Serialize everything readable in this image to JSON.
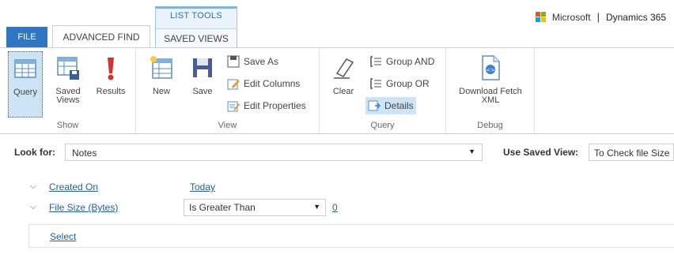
{
  "tabs": {
    "file": "FILE",
    "advanced_find": "ADVANCED FIND",
    "list_tools": "LIST TOOLS",
    "saved_views": "SAVED VIEWS"
  },
  "brand": {
    "microsoft": "Microsoft",
    "separator": "|",
    "product": "Dynamics 365"
  },
  "ribbon": {
    "show": {
      "label": "Show",
      "query": "Query",
      "saved_views_line1": "Saved",
      "saved_views_line2": "Views",
      "results": "Results"
    },
    "view": {
      "label": "View",
      "new": "New",
      "save": "Save",
      "save_as": "Save As",
      "edit_columns": "Edit Columns",
      "edit_properties": "Edit Properties"
    },
    "query": {
      "label": "Query",
      "clear": "Clear",
      "group_and": "Group AND",
      "group_or": "Group OR",
      "details": "Details"
    },
    "debug": {
      "label": "Debug",
      "download_line1": "Download Fetch",
      "download_line2": "XML"
    }
  },
  "lookfor": {
    "label": "Look for:",
    "value": "Notes",
    "use_saved_view_label": "Use Saved View:",
    "saved_view_value": "To Check file Size"
  },
  "criteria": [
    {
      "field": "Created On",
      "operator": "Today",
      "value": ""
    },
    {
      "field": "File Size (Bytes)",
      "operator": "Is Greater Than",
      "value": "0"
    }
  ],
  "select_link": "Select",
  "colors": {
    "file_tab": "#2f77c3",
    "link": "#1f5fa8",
    "selected": "#cde3f6",
    "ms_red": "#f25022",
    "ms_green": "#7fba00",
    "ms_blue": "#00a4ef",
    "ms_yellow": "#ffb900"
  }
}
